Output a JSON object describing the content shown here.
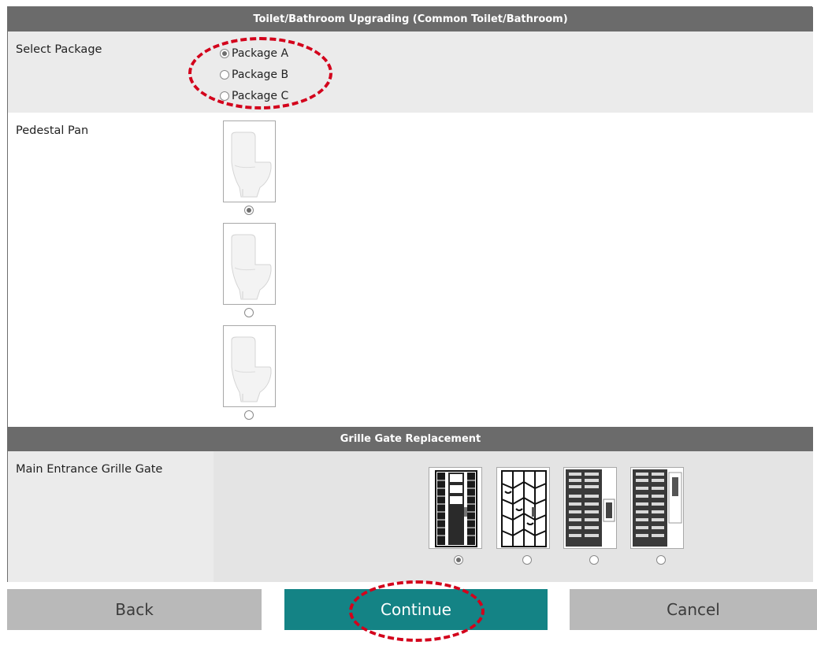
{
  "sections": {
    "toilet_header": "Toilet/Bathroom Upgrading (Common Toilet/Bathroom)",
    "grille_header": "Grille Gate Replacement"
  },
  "package": {
    "label": "Select Package",
    "options": [
      "Package A",
      "Package B",
      "Package C"
    ],
    "selected": "Package A"
  },
  "pedestal": {
    "label": "Pedestal Pan",
    "option_count_visible": 3,
    "selected_index": 0
  },
  "grille": {
    "label": "Main Entrance Grille Gate",
    "selected_index": 0
  },
  "buttons": {
    "back": "Back",
    "continue": "Continue",
    "cancel": "Cancel"
  },
  "colors": {
    "header_bg": "#6b6b6b",
    "continue_bg": "#148385",
    "secondary_btn_bg": "#b9b9b9",
    "highlight_ring": "#d3001b"
  }
}
